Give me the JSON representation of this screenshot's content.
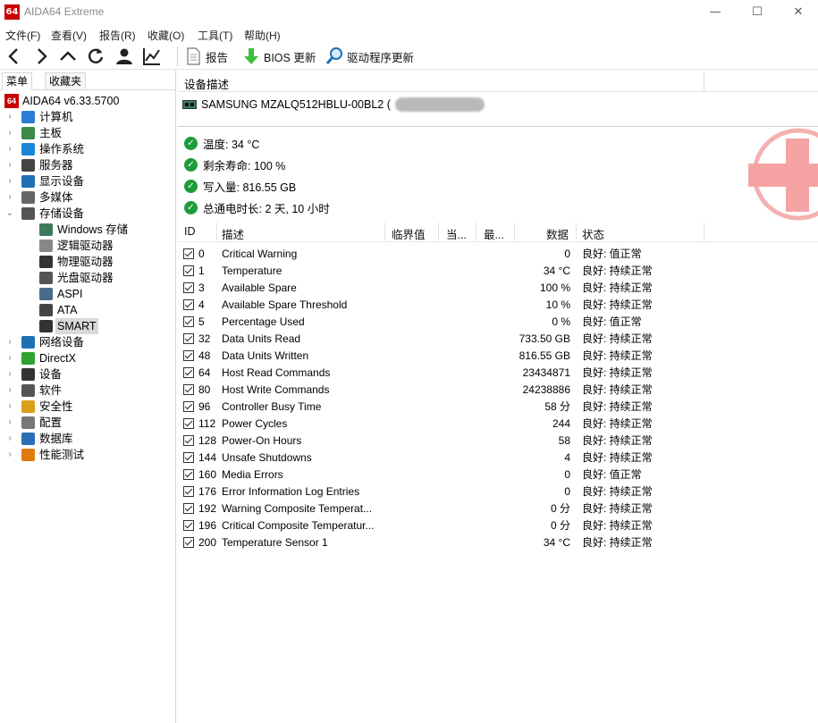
{
  "window": {
    "app_icon_text": "64",
    "title": "AIDA64 Extreme",
    "minimize_glyph": "—",
    "maximize_glyph": "☐",
    "close_glyph": "✕"
  },
  "menu": [
    "文件(F)",
    "查看(V)",
    "报告(R)",
    "收藏(O)",
    "工具(T)",
    "帮助(H)"
  ],
  "toolbar": {
    "report_label": "报告",
    "bios_label": "BIOS 更新",
    "driver_label": "驱动程序更新"
  },
  "left_panel": {
    "tabs": [
      "菜单",
      "收藏夹"
    ],
    "root_label": "AIDA64 v6.33.5700",
    "items": [
      {
        "label": "计算机",
        "icon": "computer-icon"
      },
      {
        "label": "主板",
        "icon": "motherboard-icon"
      },
      {
        "label": "操作系统",
        "icon": "windows-icon"
      },
      {
        "label": "服务器",
        "icon": "server-icon"
      },
      {
        "label": "显示设备",
        "icon": "display-icon"
      },
      {
        "label": "多媒体",
        "icon": "speaker-icon"
      },
      {
        "label": "存储设备",
        "icon": "storage-icon"
      },
      {
        "label": "Windows 存储",
        "icon": "windows-storage-icon"
      },
      {
        "label": "逻辑驱动器",
        "icon": "logical-drive-icon"
      },
      {
        "label": "物理驱动器",
        "icon": "physical-drive-icon"
      },
      {
        "label": "光盘驱动器",
        "icon": "optical-drive-icon"
      },
      {
        "label": "ASPI",
        "icon": "aspi-icon"
      },
      {
        "label": "ATA",
        "icon": "ata-icon"
      },
      {
        "label": "SMART",
        "icon": "smart-icon"
      },
      {
        "label": "网络设备",
        "icon": "network-icon"
      },
      {
        "label": "DirectX",
        "icon": "xbox-icon"
      },
      {
        "label": "设备",
        "icon": "device-icon"
      },
      {
        "label": "软件",
        "icon": "software-icon"
      },
      {
        "label": "安全性",
        "icon": "shield-icon"
      },
      {
        "label": "配置",
        "icon": "config-icon"
      },
      {
        "label": "数据库",
        "icon": "database-icon"
      },
      {
        "label": "性能测试",
        "icon": "benchmark-icon"
      }
    ]
  },
  "device": {
    "header_label": "设备描述",
    "name": "SAMSUNG MZALQ512HBLU-00BL2 ("
  },
  "status": [
    {
      "label": "温度: 34 °C"
    },
    {
      "label": "剩余寿命: 100 %"
    },
    {
      "label": "写入量: 816.55 GB"
    },
    {
      "label": "总通电时长: 2 天, 10 小时"
    }
  ],
  "table": {
    "headers": {
      "id": "ID",
      "desc": "描述",
      "threshold": "临界值",
      "current": "当...",
      "worst": "最...",
      "data": "数据",
      "status": "状态"
    },
    "rows": [
      {
        "id": "0",
        "desc": "Critical Warning",
        "data": "0",
        "status": "良好: 值正常"
      },
      {
        "id": "1",
        "desc": "Temperature",
        "data": "34 °C",
        "status": "良好: 持续正常"
      },
      {
        "id": "3",
        "desc": "Available Spare",
        "data": "100 %",
        "status": "良好: 持续正常"
      },
      {
        "id": "4",
        "desc": "Available Spare Threshold",
        "data": "10 %",
        "status": "良好: 持续正常"
      },
      {
        "id": "5",
        "desc": "Percentage Used",
        "data": "0 %",
        "status": "良好: 值正常"
      },
      {
        "id": "32",
        "desc": "Data Units Read",
        "data": "733.50 GB",
        "status": "良好: 持续正常"
      },
      {
        "id": "48",
        "desc": "Data Units Written",
        "data": "816.55 GB",
        "status": "良好: 持续正常"
      },
      {
        "id": "64",
        "desc": "Host Read Commands",
        "data": "23434871",
        "status": "良好: 持续正常"
      },
      {
        "id": "80",
        "desc": "Host Write Commands",
        "data": "24238886",
        "status": "良好: 持续正常"
      },
      {
        "id": "96",
        "desc": "Controller Busy Time",
        "data": "58 分",
        "status": "良好: 持续正常"
      },
      {
        "id": "112",
        "desc": "Power Cycles",
        "data": "244",
        "status": "良好: 持续正常"
      },
      {
        "id": "128",
        "desc": "Power-On Hours",
        "data": "58",
        "status": "良好: 持续正常"
      },
      {
        "id": "144",
        "desc": "Unsafe Shutdowns",
        "data": "4",
        "status": "良好: 持续正常"
      },
      {
        "id": "160",
        "desc": "Media Errors",
        "data": "0",
        "status": "良好: 值正常"
      },
      {
        "id": "176",
        "desc": "Error Information Log Entries",
        "data": "0",
        "status": "良好: 持续正常"
      },
      {
        "id": "192",
        "desc": "Warning Composite Temperat...",
        "data": "0 分",
        "status": "良好: 持续正常"
      },
      {
        "id": "196",
        "desc": "Critical Composite Temperatur...",
        "data": "0 分",
        "status": "良好: 持续正常"
      },
      {
        "id": "200",
        "desc": "Temperature Sensor 1",
        "data": "34 °C",
        "status": "良好: 持续正常"
      }
    ]
  },
  "colors": {
    "ok_green": "#1e9c3a",
    "brand_red": "#c80000"
  }
}
